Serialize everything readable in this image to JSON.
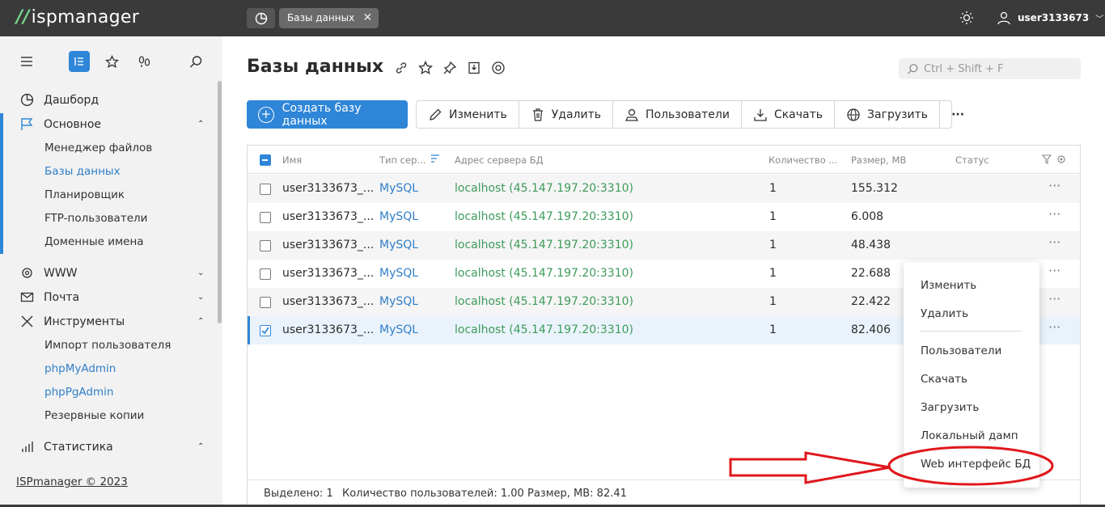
{
  "app": {
    "logo_mark": "//",
    "logo_text": "ispmanager"
  },
  "topbar": {
    "tab_label": "Базы данных",
    "tab_close": "✕",
    "username": "user3133673",
    "user_caret": "﹀"
  },
  "sidebar": {
    "items": [
      {
        "label": "Дашборд"
      },
      {
        "label": "Основное",
        "chev": "⌃"
      },
      {
        "label": "WWW",
        "chev": "⌄"
      },
      {
        "label": "Почта",
        "chev": "⌄"
      },
      {
        "label": "Инструменты",
        "chev": "⌃"
      },
      {
        "label": "Статистика",
        "chev": "⌃"
      }
    ],
    "main_sub": [
      "Менеджер файлов",
      "Базы данных",
      "Планировщик",
      "FTP-пользователи",
      "Доменные имена"
    ],
    "tools_sub": [
      "Импорт пользователя",
      "phpMyAdmin",
      "phpPgAdmin",
      "Резервные копии"
    ],
    "footer": "ISPmanager © 2023"
  },
  "main": {
    "title": "Базы данных",
    "search_placeholder": "Ctrl + Shift + F",
    "create_label": "Создать базу данных",
    "toolbar": {
      "edit": "Изменить",
      "delete": "Удалить",
      "users": "Пользователи",
      "download": "Скачать",
      "upload": "Загрузить",
      "more": "···"
    }
  },
  "table": {
    "headers": {
      "name": "Имя",
      "type": "Тип сер...",
      "address": "Адрес сервера БД",
      "count": "Количество ...",
      "size": "Размер, MB",
      "status": "Статус"
    },
    "rows": [
      {
        "name": "user3133673_...",
        "type": "MySQL",
        "address": "localhost (45.147.197.20:3310)",
        "count": "1",
        "size": "155.312",
        "selected": false
      },
      {
        "name": "user3133673_...",
        "type": "MySQL",
        "address": "localhost (45.147.197.20:3310)",
        "count": "1",
        "size": "6.008",
        "selected": false
      },
      {
        "name": "user3133673_...",
        "type": "MySQL",
        "address": "localhost (45.147.197.20:3310)",
        "count": "1",
        "size": "48.438",
        "selected": false
      },
      {
        "name": "user3133673_...",
        "type": "MySQL",
        "address": "localhost (45.147.197.20:3310)",
        "count": "1",
        "size": "22.688",
        "selected": false
      },
      {
        "name": "user3133673_...",
        "type": "MySQL",
        "address": "localhost (45.147.197.20:3310)",
        "count": "1",
        "size": "22.422",
        "selected": false
      },
      {
        "name": "user3133673_...",
        "type": "MySQL",
        "address": "localhost (45.147.197.20:3310)",
        "count": "1",
        "size": "82.406",
        "selected": true
      }
    ],
    "row_menu": "···",
    "footer": {
      "selected": "Выделено: 1",
      "users": "Количество пользователей: 1.00",
      "size": "Размер, MB: 82.41"
    }
  },
  "context_menu": [
    "Изменить",
    "Удалить",
    "Пользователи",
    "Скачать",
    "Загрузить",
    "Локальный дамп",
    "Web интерфейс БД"
  ],
  "colors": {
    "accent": "#2f86d8",
    "topbar": "#3a3a3a",
    "link": "#2f7fc8",
    "address": "#3d9b5a",
    "annotation": "#e0171c"
  }
}
